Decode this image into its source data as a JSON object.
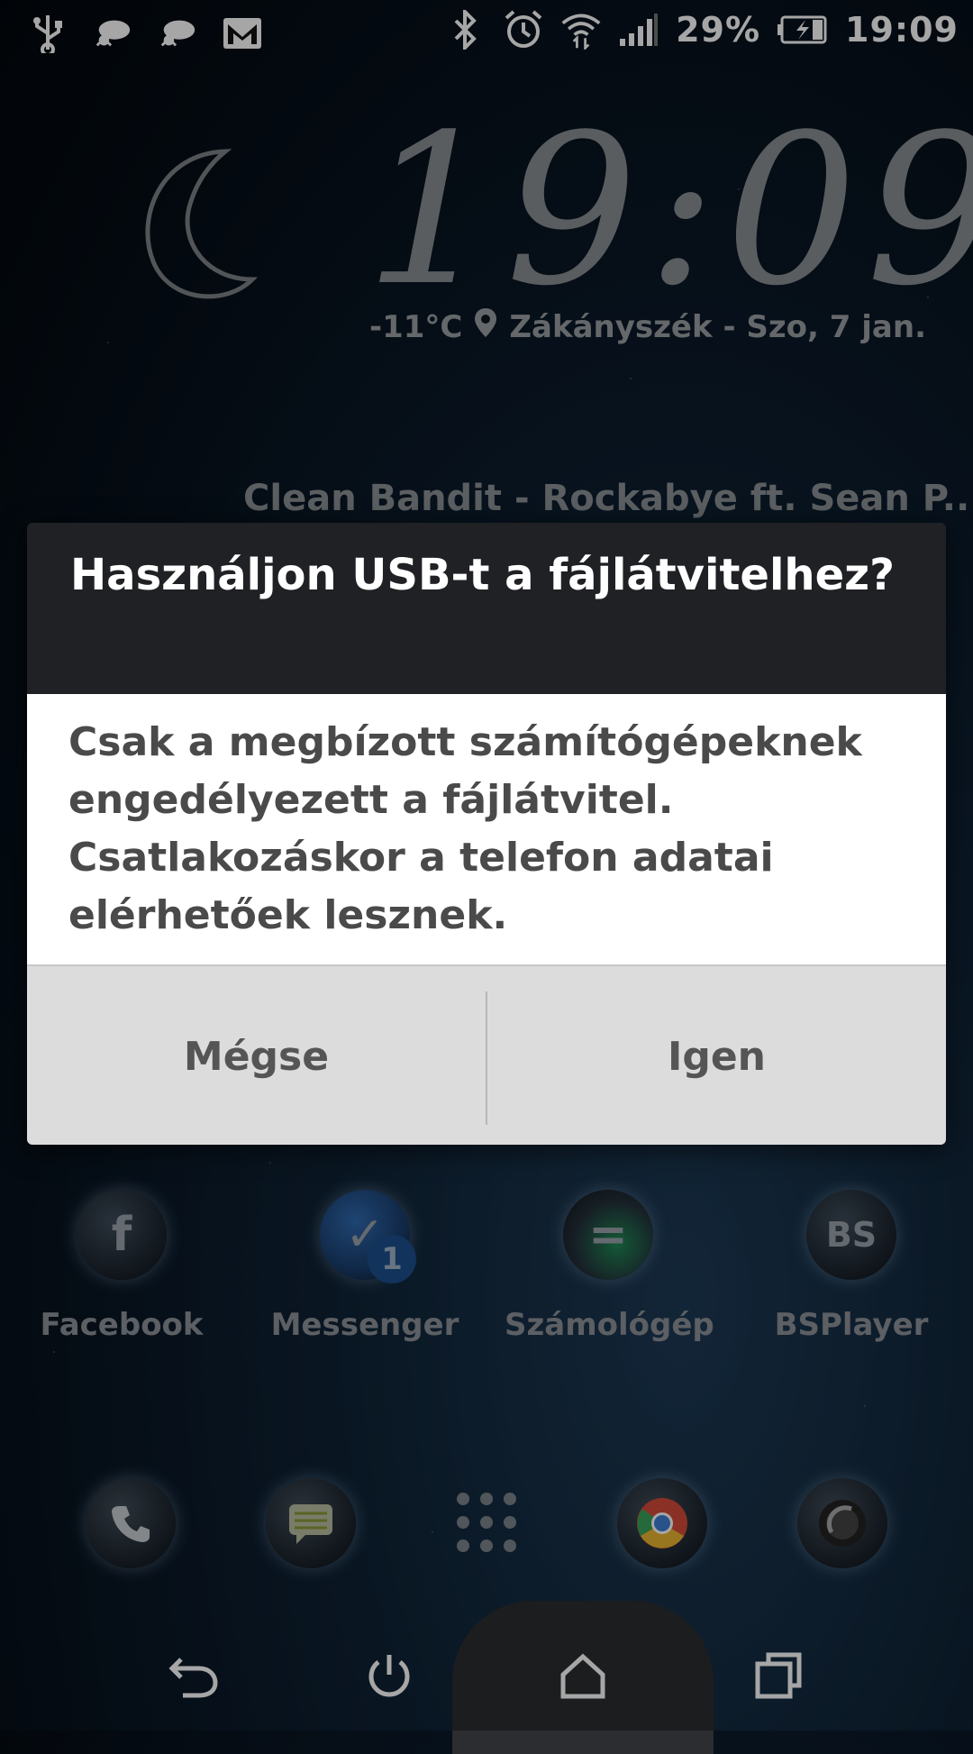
{
  "status_bar": {
    "left_icons": [
      "usb-icon",
      "weather-icon",
      "weather-icon",
      "gmail-icon"
    ],
    "right_icons": [
      "bluetooth-icon",
      "alarm-icon",
      "wifi-icon",
      "signal-icon"
    ],
    "battery_percent": "29%",
    "time": "19:09"
  },
  "clock_widget": {
    "time": "19:09",
    "temperature": "-11°C",
    "location_date": "Zákányszék - Szo, 7 jan.",
    "now_playing": "Clean Bandit - Rockabye ft. Sean P.."
  },
  "dialog": {
    "title": "Használjon USB-t a fájlátvitelhez?",
    "message": "Csak a megbízott számítógépeknek engedélyezett a fájlátvitel. Csatlakozáskor a telefon adatai elérhetőek lesznek.",
    "cancel_label": "Mégse",
    "confirm_label": "Igen"
  },
  "apps": [
    {
      "label": "Facebook",
      "icon": "facebook-icon",
      "glyph": "f"
    },
    {
      "label": "Messenger",
      "icon": "messenger-icon",
      "glyph": "✓",
      "badge": "1"
    },
    {
      "label": "Számológép",
      "icon": "calculator-icon",
      "glyph": "="
    },
    {
      "label": "BSPlayer",
      "icon": "bsplayer-icon",
      "glyph": "BS"
    }
  ],
  "dock": {
    "items": [
      "phone-icon",
      "messages-icon",
      "app-drawer-icon",
      "chrome-icon",
      "camera-icon"
    ]
  },
  "nav_bar": {
    "items": [
      "back-icon",
      "power-icon",
      "home-icon",
      "recents-icon"
    ]
  }
}
